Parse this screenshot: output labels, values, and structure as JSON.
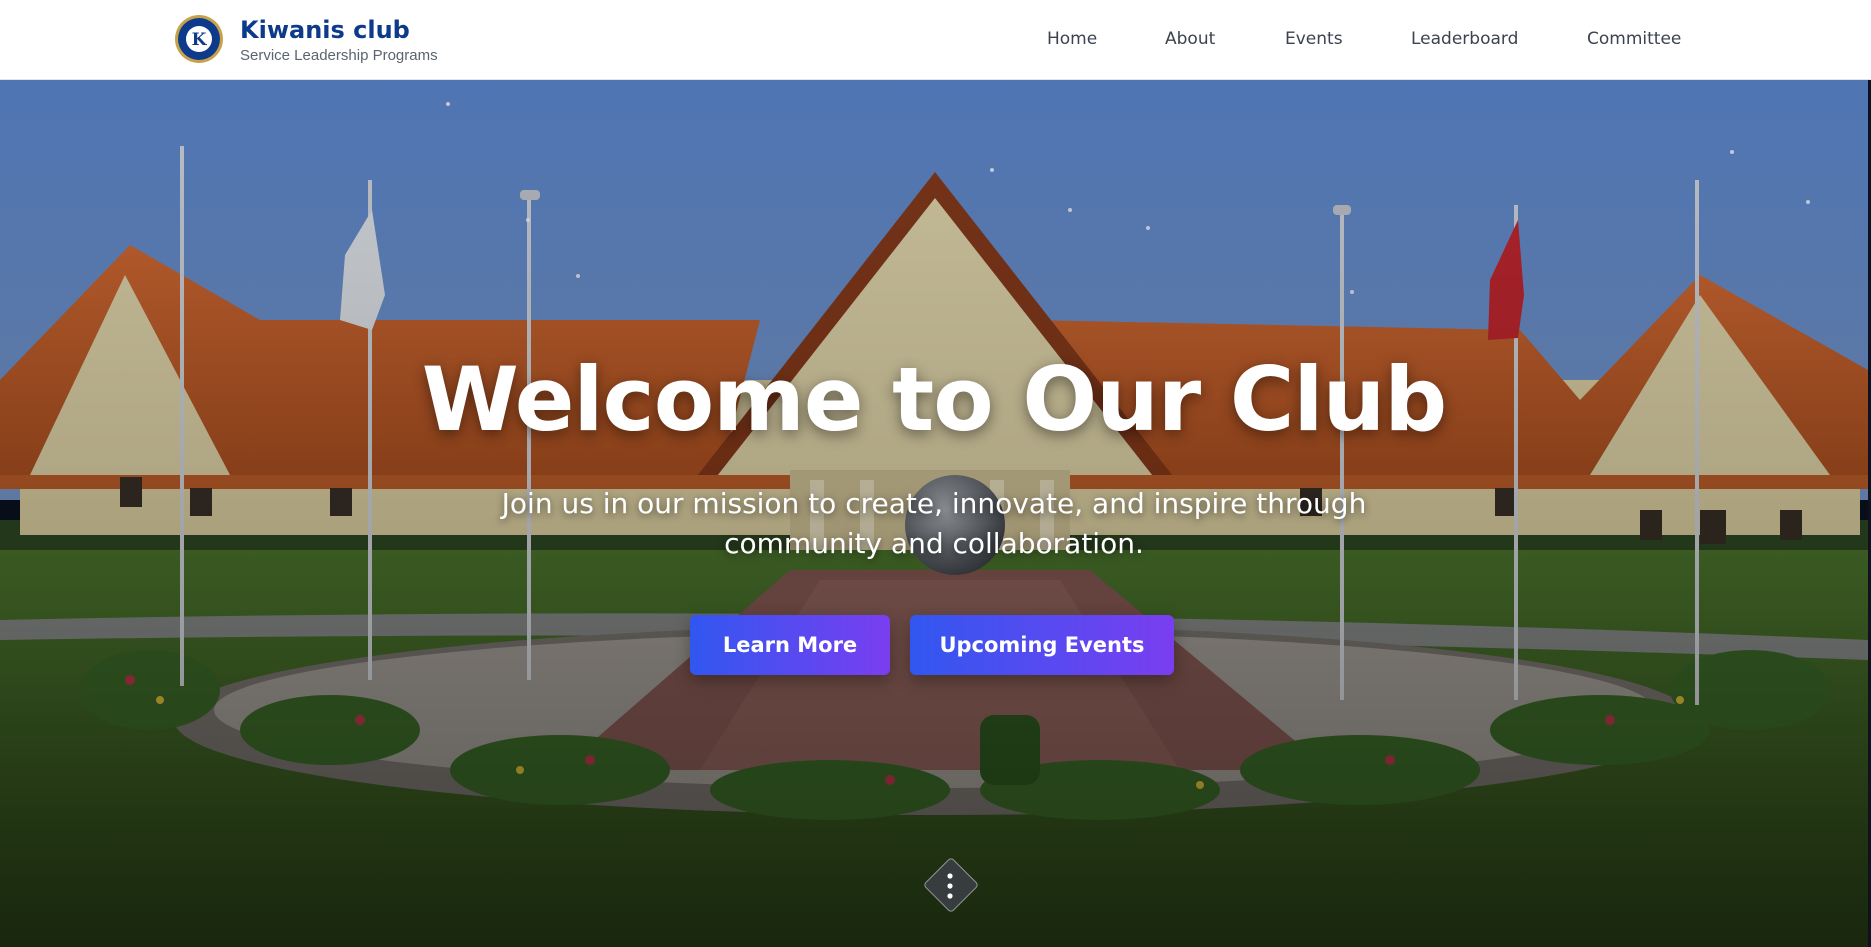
{
  "header": {
    "title": "Kiwanis club",
    "subtitle": "Service Leadership Programs",
    "logo_icon": "kiwanis-logo-icon",
    "nav": [
      {
        "label": "Home"
      },
      {
        "label": "About"
      },
      {
        "label": "Events"
      },
      {
        "label": "Leaderboard"
      },
      {
        "label": "Committee"
      }
    ]
  },
  "hero": {
    "title": "Welcome to Our Club",
    "subtitle": "Join us in our mission to create, innovate, and inspire through community and collaboration.",
    "buttons": {
      "learn_more": "Learn More",
      "upcoming_events": "Upcoming Events"
    },
    "scroll_icon": "scroll-down-indicator-icon"
  },
  "colors": {
    "brand": "#0d3a8a",
    "button_start": "#3157f0",
    "button_end": "#7a3ef0"
  }
}
